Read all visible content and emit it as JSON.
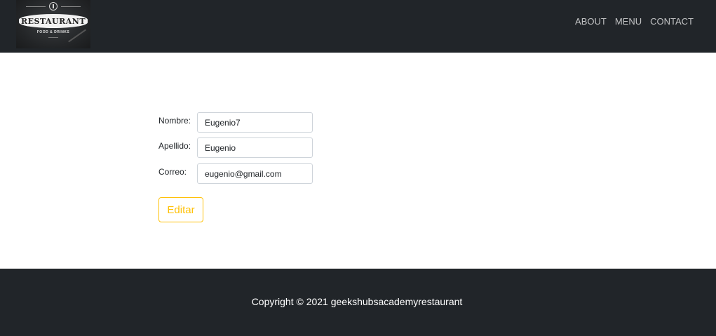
{
  "header": {
    "logo": {
      "title": "RESTAURANT",
      "subtitle": "FOOD & DRINKS"
    },
    "nav": [
      {
        "label": "ABOUT"
      },
      {
        "label": "MENU"
      },
      {
        "label": "CONTACT"
      }
    ]
  },
  "form": {
    "fields": [
      {
        "label": "Nombre:",
        "value": "Eugenio7"
      },
      {
        "label": "Apellido:",
        "value": "Eugenio"
      },
      {
        "label": "Correo:",
        "value": "eugenio@gmail.com"
      }
    ],
    "submit_label": "Editar"
  },
  "footer": {
    "copyright": "Copyright © 2021 geekshubsacademyrestaurant"
  },
  "colors": {
    "navbar": "#212529",
    "accent": "#ffc107",
    "nav_text": "rgba(255,255,255,0.72)"
  }
}
